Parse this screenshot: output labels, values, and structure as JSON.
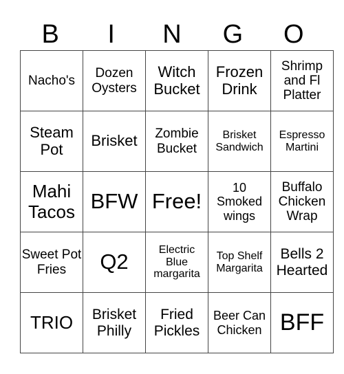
{
  "header": [
    "B",
    "I",
    "N",
    "G",
    "O"
  ],
  "rows": [
    [
      {
        "text": "Nacho's",
        "size": "s19"
      },
      {
        "text": "Dozen Oysters",
        "size": "s19"
      },
      {
        "text": "Witch Bucket",
        "size": "s22"
      },
      {
        "text": "Frozen Drink",
        "size": "s22"
      },
      {
        "text": "Shrimp and Fl Platter",
        "size": "s19"
      }
    ],
    [
      {
        "text": "Steam Pot",
        "size": "s22"
      },
      {
        "text": "Brisket",
        "size": "s22"
      },
      {
        "text": "Zombie Bucket",
        "size": "s19"
      },
      {
        "text": "Brisket Sandwich",
        "size": "s16"
      },
      {
        "text": "Espresso Martini",
        "size": "s16"
      }
    ],
    [
      {
        "text": "Mahi Tacos",
        "size": "s26"
      },
      {
        "text": "BFW",
        "size": "s30"
      },
      {
        "text": "Free!",
        "size": "s30"
      },
      {
        "text": "10 Smoked wings",
        "size": "s18"
      },
      {
        "text": "Buffalo Chicken Wrap",
        "size": "s19"
      }
    ],
    [
      {
        "text": "Sweet Pot Fries",
        "size": "s19"
      },
      {
        "text": "Q2",
        "size": "s30"
      },
      {
        "text": "Electric Blue margarita",
        "size": "s16"
      },
      {
        "text": "Top Shelf Margarita",
        "size": "s16"
      },
      {
        "text": "Bells 2 Hearted",
        "size": "s21"
      }
    ],
    [
      {
        "text": "TRIO",
        "size": "s26"
      },
      {
        "text": "Brisket Philly",
        "size": "s21"
      },
      {
        "text": "Fried Pickles",
        "size": "s21"
      },
      {
        "text": "Beer Can Chicken",
        "size": "s18"
      },
      {
        "text": "BFF",
        "size": "s34"
      }
    ]
  ]
}
